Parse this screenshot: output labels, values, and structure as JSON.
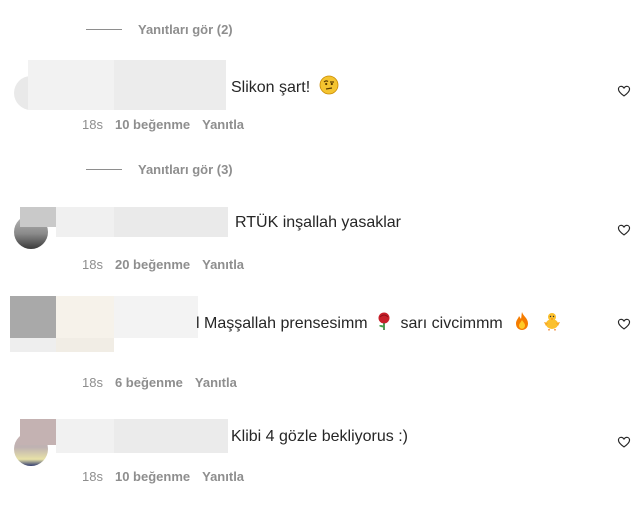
{
  "comments": [
    {
      "view_replies": "Yanıtları gör (2)",
      "text": "Slikon şart!",
      "emoji": "face-with-raised-eyebrow",
      "time": "18s",
      "likes": "10 beğenme",
      "reply": "Yanıtla"
    },
    {
      "view_replies": "Yanıtları gör (3)",
      "text": "RTÜK inşallah yasaklar",
      "time": "18s",
      "likes": "20 beğenme",
      "reply": "Yanıtla"
    },
    {
      "text_prefix": "l",
      "text": "Maşşallah prensesimm",
      "text2": "sarı civcimmm",
      "emojis": [
        "rose-icon",
        "fire-icon",
        "chick-icon"
      ],
      "time": "18s",
      "likes": "6 beğenme",
      "reply": "Yanıtla"
    },
    {
      "text": "Klibi 4 gözle bekliyorus :)",
      "time": "18s",
      "likes": "10 beğenme",
      "reply": "Yanıtla"
    }
  ],
  "colors": {
    "text": "#262626",
    "secondary": "#8e8e8e",
    "background": "#ffffff"
  }
}
